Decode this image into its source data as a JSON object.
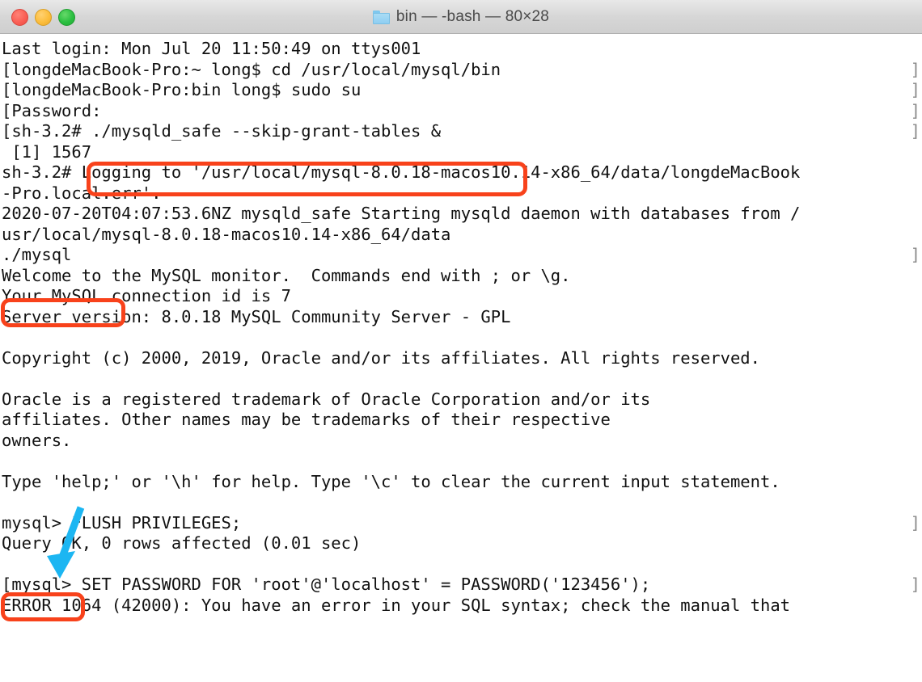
{
  "window": {
    "title": "bin — -bash — 80×28",
    "folder_icon": "folder-icon",
    "traffic_lights": [
      {
        "name": "close",
        "color": "#fa5f55"
      },
      {
        "name": "minimize",
        "color": "#fcbd3c"
      },
      {
        "name": "zoom",
        "color": "#2bbf41"
      }
    ]
  },
  "terminal": {
    "columns": 80,
    "rows": 28,
    "shell": "-bash",
    "foreground": "#111111",
    "background": "#ffffff",
    "marker_color": "#8a8a8a",
    "lines": [
      {
        "text": "Last login: Mon Jul 20 11:50:49 on ttys001",
        "marker": false
      },
      {
        "text": "[longdeMacBook-Pro:~ long$ cd /usr/local/mysql/bin",
        "marker": true
      },
      {
        "text": "[longdeMacBook-Pro:bin long$ sudo su",
        "marker": true
      },
      {
        "text": "[Password:",
        "marker": true
      },
      {
        "text": "[sh-3.2# ./mysqld_safe --skip-grant-tables &",
        "marker": true
      },
      {
        "text": " [1] 1567",
        "marker": false
      },
      {
        "text": "sh-3.2# Logging to '/usr/local/mysql-8.0.18-macos10.14-x86_64/data/longdeMacBook",
        "marker": false
      },
      {
        "text": "-Pro.local.err'.",
        "marker": false
      },
      {
        "text": "2020-07-20T04:07:53.6NZ mysqld_safe Starting mysqld daemon with databases from /",
        "marker": false
      },
      {
        "text": "usr/local/mysql-8.0.18-macos10.14-x86_64/data",
        "marker": false
      },
      {
        "text": "./mysql",
        "marker": true
      },
      {
        "text": "Welcome to the MySQL monitor.  Commands end with ; or \\g.",
        "marker": false
      },
      {
        "text": "Your MySQL connection id is 7",
        "marker": false
      },
      {
        "text": "Server version: 8.0.18 MySQL Community Server - GPL",
        "marker": false
      },
      {
        "text": "",
        "marker": false
      },
      {
        "text": "Copyright (c) 2000, 2019, Oracle and/or its affiliates. All rights reserved.",
        "marker": false
      },
      {
        "text": "",
        "marker": false
      },
      {
        "text": "Oracle is a registered trademark of Oracle Corporation and/or its",
        "marker": false
      },
      {
        "text": "affiliates. Other names may be trademarks of their respective",
        "marker": false
      },
      {
        "text": "owners.",
        "marker": false
      },
      {
        "text": "",
        "marker": false
      },
      {
        "text": "Type 'help;' or '\\h' for help. Type '\\c' to clear the current input statement.",
        "marker": false
      },
      {
        "text": "",
        "marker": false
      },
      {
        "text": "mysql> FLUSH PRIVILEGES;",
        "marker": true
      },
      {
        "text": "Query OK, 0 rows affected (0.01 sec)",
        "marker": false
      },
      {
        "text": "",
        "marker": false
      },
      {
        "text": "[mysql> SET PASSWORD FOR 'root'@'localhost' = PASSWORD('123456');",
        "marker": true
      },
      {
        "text": "ERROR 1064 (42000): You have an error in your SQL syntax; check the manual that",
        "marker": false
      }
    ]
  },
  "annotations": {
    "color": "#f8421b",
    "arrow_color": "#1cb6f2",
    "boxes": [
      {
        "id": "mysqld-safe-command",
        "label": "./mysqld_safe --skip-grant-tables &"
      },
      {
        "id": "mysql-client-command",
        "label": "./mysql"
      },
      {
        "id": "mysql-prompt",
        "label": "mysql>"
      }
    ],
    "arrow": {
      "id": "help-line-arrow",
      "points_to": "Type 'help;'"
    }
  }
}
